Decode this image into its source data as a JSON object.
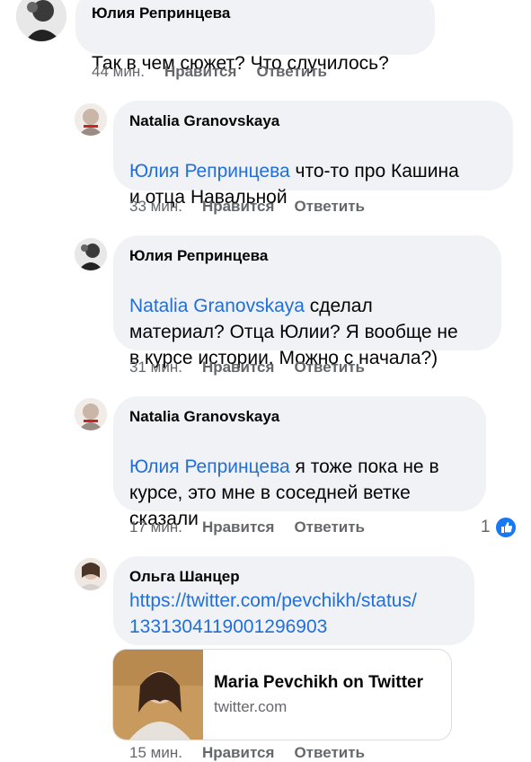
{
  "actions": {
    "like": "Нравится",
    "reply": "Ответить"
  },
  "comments": [
    {
      "author": "Юлия Репринцева",
      "mention": "",
      "text": "Так в чем сюжет? Что случилось?",
      "time": "44 мин."
    },
    {
      "author": "Natalia Granovskaya",
      "mention": "Юлия Репринцева",
      "text": " что-то про Кашина\nи отца Навальной",
      "time": "33 мин."
    },
    {
      "author": "Юлия Репринцева",
      "mention": "Natalia Granovskaya",
      "text": " сделал\nматериал? Отца Юлии? Я вообще не\nв курсе истории. Можно с начала?)",
      "time": "31 мин."
    },
    {
      "author": "Natalia Granovskaya",
      "mention": "Юлия Репринцева",
      "text": " я тоже пока не в\nкурсе, это мне в соседней ветке\nсказали",
      "time": "17 мин.",
      "reaction_count": "1"
    },
    {
      "author": "Ольга Шанцер",
      "link": "https://twitter.com/pevchikh/status/\n1331304119001296903",
      "time": "15 мин."
    }
  ],
  "link_preview": {
    "title": "Maria Pevchikh on Twitter",
    "domain": "twitter.com"
  },
  "colors": {
    "accent": "#216fdb",
    "bubble": "#f0f2f5",
    "like": "#1877f2"
  }
}
